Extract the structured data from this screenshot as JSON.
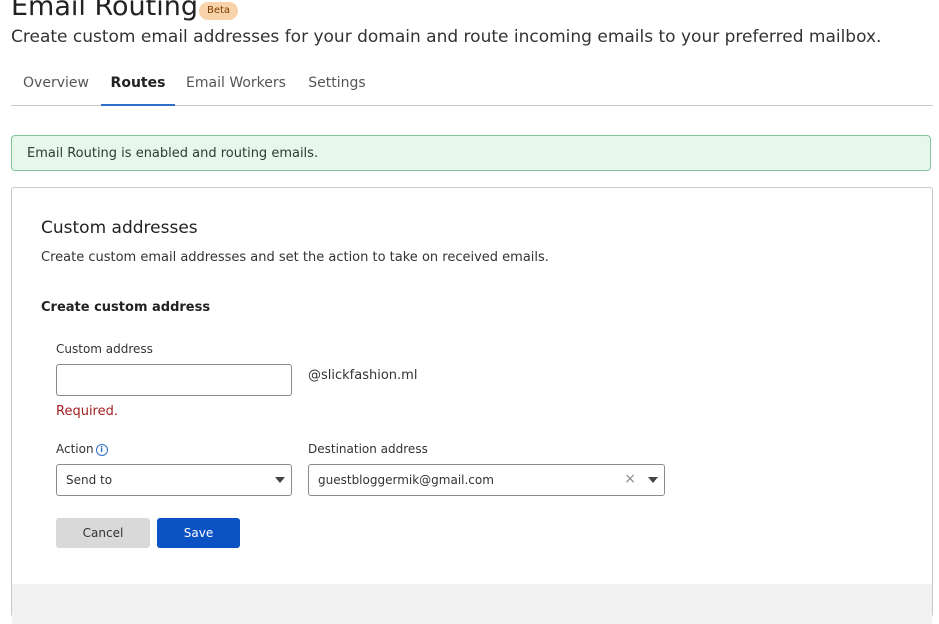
{
  "header": {
    "title": "Email Routing",
    "badge": "Beta",
    "subtitle": "Create custom email addresses for your domain and route incoming emails to your preferred mailbox."
  },
  "tabs": [
    {
      "label": "Overview",
      "active": false
    },
    {
      "label": "Routes",
      "active": true
    },
    {
      "label": "Email Workers",
      "active": false
    },
    {
      "label": "Settings",
      "active": false
    }
  ],
  "notice": {
    "text": "Email Routing is enabled and routing emails.",
    "color": "#e7f7ec"
  },
  "card": {
    "title": "Custom addresses",
    "description": "Create custom email addresses and set the action to take on received emails.",
    "section_title": "Create custom address"
  },
  "form": {
    "custom_address_label": "Custom address",
    "custom_address_value": "",
    "domain_suffix": "@slickfashion.ml",
    "error": "Required.",
    "action_label": "Action",
    "action_value": "Send to",
    "destination_label": "Destination address",
    "destination_value": "guestbloggermik@gmail.com",
    "clear_symbol": "×",
    "cancel_label": "Cancel",
    "save_label": "Save"
  },
  "colors": {
    "accent": "#0b52c4",
    "error": "#a32222",
    "badge": "#f8d2a8"
  }
}
